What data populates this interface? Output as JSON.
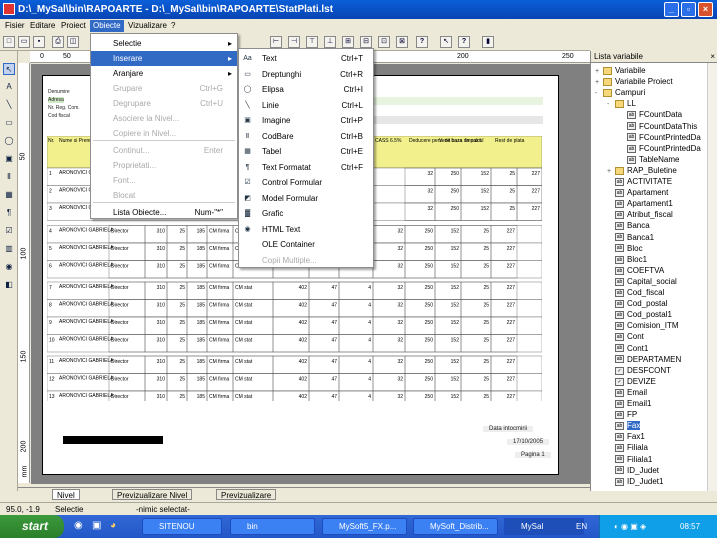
{
  "window": {
    "title": "D:\\_MySal\\bin\\RAPOARTE - D:\\_MySal\\bin\\RAPOARTE\\StatPlati.lst"
  },
  "menubar": [
    "Fisier",
    "Editare",
    "Proiect",
    "Obiecte",
    "Vizualizare",
    "?"
  ],
  "obiecte_menu": [
    {
      "label": "Selectie",
      "shortcut": "",
      "arrow": "▸",
      "disabled": false
    },
    {
      "label": "Inserare",
      "shortcut": "",
      "arrow": "▸",
      "disabled": false
    },
    {
      "label": "Aranjare",
      "shortcut": "",
      "arrow": "▸",
      "disabled": false
    },
    {
      "label": "Grupare",
      "shortcut": "Ctrl+G",
      "arrow": "",
      "disabled": true
    },
    {
      "label": "Degrupare",
      "shortcut": "Ctrl+U",
      "arrow": "",
      "disabled": true
    },
    {
      "label": "Asociere la Nivel...",
      "shortcut": "",
      "arrow": "",
      "disabled": true
    },
    {
      "label": "Copiere in Nivel...",
      "shortcut": "",
      "arrow": "",
      "disabled": true
    },
    {
      "label": "Continut...",
      "shortcut": "Enter",
      "arrow": "",
      "disabled": true
    },
    {
      "label": "Proprietati...",
      "shortcut": "",
      "arrow": "",
      "disabled": true
    },
    {
      "label": "Font...",
      "shortcut": "",
      "arrow": "",
      "disabled": true
    },
    {
      "label": "Blocat",
      "shortcut": "",
      "arrow": "",
      "disabled": true
    },
    {
      "label": "Lista Obiecte...",
      "shortcut": "Num-\"*\"",
      "arrow": "",
      "disabled": false
    }
  ],
  "inserare_menu": [
    {
      "label": "Text",
      "shortcut": "Ctrl+T",
      "icon": "Aa",
      "disabled": false
    },
    {
      "label": "Dreptunghi",
      "shortcut": "Ctrl+R",
      "icon": "▭",
      "disabled": false
    },
    {
      "label": "Elipsa",
      "shortcut": "Ctrl+I",
      "icon": "◯",
      "disabled": false
    },
    {
      "label": "Linie",
      "shortcut": "Ctrl+L",
      "icon": "╲",
      "disabled": false
    },
    {
      "label": "Imagine",
      "shortcut": "Ctrl+P",
      "icon": "▣",
      "disabled": false
    },
    {
      "label": "CodBare",
      "shortcut": "Ctrl+B",
      "icon": "Ⅱ",
      "disabled": false
    },
    {
      "label": "Tabel",
      "shortcut": "Ctrl+E",
      "icon": "▦",
      "disabled": false
    },
    {
      "label": "Text Formatat",
      "shortcut": "Ctrl+F",
      "icon": "¶",
      "disabled": false
    },
    {
      "label": "Control Formular",
      "shortcut": "",
      "icon": "☑",
      "disabled": false
    },
    {
      "label": "Model Formular",
      "shortcut": "",
      "icon": "◩",
      "disabled": false
    },
    {
      "label": "Grafic",
      "shortcut": "",
      "icon": "▓",
      "disabled": false
    },
    {
      "label": "HTML Text",
      "shortcut": "",
      "icon": "◉",
      "disabled": false
    },
    {
      "label": "OLE Container",
      "shortcut": "",
      "icon": "",
      "disabled": false
    },
    {
      "label": "Copii Multiple...",
      "shortcut": "",
      "icon": "",
      "disabled": true
    }
  ],
  "ruler_top": [
    "0",
    "50",
    "200",
    "250"
  ],
  "ruler_left": [
    "50",
    "100",
    "150",
    "200",
    "mm"
  ],
  "ruler_corner": "mm",
  "report": {
    "labels": [
      "Denumire",
      "Adresa",
      "Nr. Reg. Com.",
      "Cod fiscal"
    ],
    "headers": [
      "Nr.",
      "Nume si Prenume Marca",
      "CASS 6.5%",
      "Deducere pers. de baza",
      "Venit baza de calcul",
      "Impozit",
      "Rest de plata"
    ],
    "rows": [
      {
        "nr": "4",
        "name": "ARONOVICI GABRIELA",
        "func": "Director",
        "v1": "310",
        "v2": "25",
        "v3": "185",
        "f1": "CM firma",
        "f2": "CM stat",
        "v4": "402",
        "v5": "47",
        "v6": "4",
        "v7": "32",
        "v8": "250",
        "v9": "152",
        "v10": "25",
        "v11": "227"
      },
      {
        "nr": "5",
        "name": "ARONOVICI GABRIELA",
        "func": "Director",
        "v1": "310",
        "v2": "25",
        "v3": "185",
        "f1": "CM firma",
        "f2": "CM stat",
        "v4": "402",
        "v5": "47",
        "v6": "4",
        "v7": "32",
        "v8": "250",
        "v9": "152",
        "v10": "25",
        "v11": "227"
      },
      {
        "nr": "6",
        "name": "ARONOVICI GABRIELA",
        "func": "Director",
        "v1": "310",
        "v2": "25",
        "v3": "185",
        "f1": "CM firma",
        "f2": "CM stat",
        "v4": "402",
        "v5": "47",
        "v6": "4",
        "v7": "32",
        "v8": "250",
        "v9": "152",
        "v10": "25",
        "v11": "227"
      },
      {
        "nr": "7",
        "name": "ARONOVICI GABRIELA",
        "func": "Director",
        "v1": "310",
        "v2": "25",
        "v3": "185",
        "f1": "CM firma",
        "f2": "CM stat",
        "v4": "402",
        "v5": "47",
        "v6": "4",
        "v7": "32",
        "v8": "250",
        "v9": "152",
        "v10": "25",
        "v11": "227"
      },
      {
        "nr": "8",
        "name": "ARONOVICI GABRIELA",
        "func": "Director",
        "v1": "310",
        "v2": "25",
        "v3": "185",
        "f1": "CM firma",
        "f2": "CM stat",
        "v4": "402",
        "v5": "47",
        "v6": "4",
        "v7": "32",
        "v8": "250",
        "v9": "152",
        "v10": "25",
        "v11": "227"
      },
      {
        "nr": "9",
        "name": "ARONOVICI GABRIELA",
        "func": "Director",
        "v1": "310",
        "v2": "25",
        "v3": "185",
        "f1": "CM firma",
        "f2": "CM stat",
        "v4": "402",
        "v5": "47",
        "v6": "4",
        "v7": "32",
        "v8": "250",
        "v9": "152",
        "v10": "25",
        "v11": "227"
      },
      {
        "nr": "10",
        "name": "ARONOVICI GABRIELA",
        "func": "Director",
        "v1": "310",
        "v2": "25",
        "v3": "185",
        "f1": "CM firma",
        "f2": "CM stat",
        "v4": "402",
        "v5": "47",
        "v6": "4",
        "v7": "32",
        "v8": "250",
        "v9": "152",
        "v10": "25",
        "v11": "227"
      },
      {
        "nr": "11",
        "name": "ARONOVICI GABRIELA",
        "func": "Director",
        "v1": "310",
        "v2": "25",
        "v3": "185",
        "f1": "CM firma",
        "f2": "CM stat",
        "v4": "402",
        "v5": "47",
        "v6": "4",
        "v7": "32",
        "v8": "250",
        "v9": "152",
        "v10": "25",
        "v11": "227"
      },
      {
        "nr": "12",
        "name": "ARONOVICI GABRIELA",
        "func": "Director",
        "v1": "310",
        "v2": "25",
        "v3": "185",
        "f1": "CM firma",
        "f2": "CM stat",
        "v4": "402",
        "v5": "47",
        "v6": "4",
        "v7": "32",
        "v8": "250",
        "v9": "152",
        "v10": "25",
        "v11": "227"
      },
      {
        "nr": "13",
        "name": "ARONOVICI GABRIELA",
        "func": "Director",
        "v1": "310",
        "v2": "25",
        "v3": "185",
        "f1": "CM firma",
        "f2": "CM stat",
        "v4": "402",
        "v5": "47",
        "v6": "4",
        "v7": "32",
        "v8": "250",
        "v9": "152",
        "v10": "25",
        "v11": "227"
      }
    ],
    "top_rows": [
      {
        "nr": "1",
        "name": "ARONOVICI GABRIELA",
        "v7": "32",
        "v8": "250",
        "v9": "152",
        "v10": "25",
        "v11": "227"
      },
      {
        "nr": "2",
        "name": "ARONOVICI GABRIELA",
        "v7": "32",
        "v8": "250",
        "v9": "152",
        "v10": "25",
        "v11": "227"
      },
      {
        "nr": "3",
        "name": "ARONOVICI GABRIELA",
        "v7": "32",
        "v8": "250",
        "v9": "152",
        "v10": "25",
        "v11": "227"
      }
    ],
    "total": {
      "label": "TOTAL",
      "v1": "4.030",
      "v2": "325",
      "v3": "4.030",
      "f1": "CM firma",
      "f2": "CM stat",
      "v4": "5.226",
      "v5": "611",
      "v6": "52",
      "v7": "416",
      "v8": "3.250",
      "v9": "1.976",
      "v10": "325",
      "v11": "2.951"
    },
    "data_label": "Data intocmirii",
    "date": "17/10/2005",
    "page": "Pagina 1"
  },
  "panel": {
    "title": "Lista variabile",
    "close": "×",
    "tree": [
      {
        "label": "Variabile",
        "level": 1,
        "kind": "folder",
        "exp": "+"
      },
      {
        "label": "Variabile Proiect",
        "level": 1,
        "kind": "folder",
        "exp": "+"
      },
      {
        "label": "Campuri",
        "level": 1,
        "kind": "folder",
        "exp": "-"
      },
      {
        "label": "LL",
        "level": 2,
        "kind": "folder",
        "exp": "-"
      },
      {
        "label": "FCountData",
        "level": 3,
        "kind": "field",
        "exp": ""
      },
      {
        "label": "FCountDataThis",
        "level": 3,
        "kind": "field",
        "exp": ""
      },
      {
        "label": "FCountPrintedDa",
        "level": 3,
        "kind": "field",
        "exp": ""
      },
      {
        "label": "FCountPrintedDa",
        "level": 3,
        "kind": "field",
        "exp": ""
      },
      {
        "label": "TableName",
        "level": 3,
        "kind": "field",
        "exp": ""
      },
      {
        "label": "RAP_Buletine",
        "level": 2,
        "kind": "folder",
        "exp": "+"
      },
      {
        "label": "ACTIVITATE",
        "level": 2,
        "kind": "field",
        "exp": ""
      },
      {
        "label": "Apartament",
        "level": 2,
        "kind": "field",
        "exp": ""
      },
      {
        "label": "Apartament1",
        "level": 2,
        "kind": "field",
        "exp": ""
      },
      {
        "label": "Atribut_fiscal",
        "level": 2,
        "kind": "field",
        "exp": ""
      },
      {
        "label": "Banca",
        "level": 2,
        "kind": "field",
        "exp": ""
      },
      {
        "label": "Banca1",
        "level": 2,
        "kind": "field",
        "exp": ""
      },
      {
        "label": "Bloc",
        "level": 2,
        "kind": "field",
        "exp": ""
      },
      {
        "label": "Bloc1",
        "level": 2,
        "kind": "field",
        "exp": ""
      },
      {
        "label": "COEFTVA",
        "level": 2,
        "kind": "field",
        "exp": ""
      },
      {
        "label": "Capital_social",
        "level": 2,
        "kind": "field",
        "exp": ""
      },
      {
        "label": "Cod_fiscal",
        "level": 2,
        "kind": "field",
        "exp": ""
      },
      {
        "label": "Cod_postal",
        "level": 2,
        "kind": "field",
        "exp": ""
      },
      {
        "label": "Cod_postal1",
        "level": 2,
        "kind": "field",
        "exp": ""
      },
      {
        "label": "Comision_ITM",
        "level": 2,
        "kind": "field",
        "exp": ""
      },
      {
        "label": "Cont",
        "level": 2,
        "kind": "field",
        "exp": ""
      },
      {
        "label": "Cont1",
        "level": 2,
        "kind": "field",
        "exp": ""
      },
      {
        "label": "DEPARTAMEN",
        "level": 2,
        "kind": "field",
        "exp": ""
      },
      {
        "label": "DESFCONT",
        "level": 2,
        "kind": "check",
        "exp": ""
      },
      {
        "label": "DEVIZE",
        "level": 2,
        "kind": "check",
        "exp": ""
      },
      {
        "label": "Email",
        "level": 2,
        "kind": "field",
        "exp": ""
      },
      {
        "label": "Email1",
        "level": 2,
        "kind": "field",
        "exp": ""
      },
      {
        "label": "FP",
        "level": 2,
        "kind": "field",
        "exp": ""
      },
      {
        "label": "Fax",
        "level": 2,
        "kind": "field",
        "exp": "",
        "selected": true
      },
      {
        "label": "Fax1",
        "level": 2,
        "kind": "field",
        "exp": ""
      },
      {
        "label": "Filiala",
        "level": 2,
        "kind": "field",
        "exp": ""
      },
      {
        "label": "Filiala1",
        "level": 2,
        "kind": "field",
        "exp": ""
      },
      {
        "label": "ID_Judet",
        "level": 2,
        "kind": "field",
        "exp": ""
      },
      {
        "label": "ID_Judet1",
        "level": 2,
        "kind": "field",
        "exp": ""
      }
    ]
  },
  "tabs": [
    "Nivel",
    "Previzualizare Nivel",
    "Previzualizare"
  ],
  "status": {
    "coords": "95.0, -1.9",
    "mode": "Selectie",
    "info": "-nimic selectat-"
  },
  "taskbar": {
    "start": "start",
    "tasks": [
      "SITENOU",
      "bin",
      "MySoft5_FX.p...",
      "MySoft_Distrib...",
      "MySal"
    ],
    "lang": "EN",
    "clock": "08:57"
  }
}
